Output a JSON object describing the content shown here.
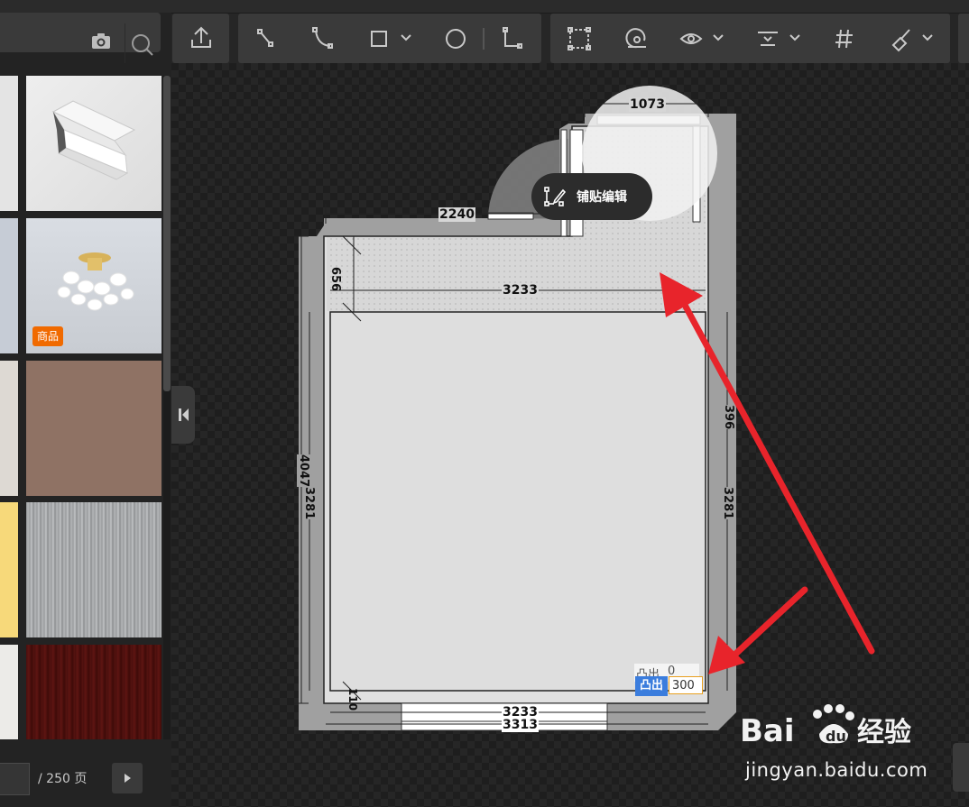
{
  "toolbar": {
    "groups": [
      {
        "name": "upload-group",
        "tools": [
          "upload-icon"
        ]
      },
      {
        "name": "draw-group",
        "tools": [
          "line-tool-icon",
          "arc-tool-icon",
          "rect-tool-icon",
          "circle-tool-icon",
          "corner-tool-icon"
        ]
      },
      {
        "name": "view-group",
        "tools": [
          "select-region-icon",
          "spiral-icon",
          "eye-icon",
          "align-icon",
          "grid-icon",
          "brush-icon"
        ]
      }
    ]
  },
  "sidebar": {
    "tiles": [
      {
        "name": "partial-tile-1",
        "badge": ""
      },
      {
        "name": "crown-molding",
        "badge": ""
      },
      {
        "name": "partial-tile-2",
        "badge": ""
      },
      {
        "name": "ceiling-lamp",
        "badge": "商品"
      },
      {
        "name": "partial-tile-3",
        "badge": ""
      },
      {
        "name": "brown-material",
        "badge": ""
      },
      {
        "name": "yellow-material",
        "badge": ""
      },
      {
        "name": "gray-metal-material",
        "badge": ""
      },
      {
        "name": "white-material",
        "badge": ""
      },
      {
        "name": "dark-wood-material",
        "badge": ""
      }
    ],
    "pager": {
      "total": "/ 250 页"
    }
  },
  "popup": {
    "label": "铺贴编辑"
  },
  "plan": {
    "dims": {
      "top_width": "1073",
      "left_top": "2240",
      "side_small": "656",
      "inner_width": "3233",
      "left_outer": "4047",
      "left_inner": "3281",
      "right_inner": "3281",
      "right_top": "396",
      "bottom_small": "110",
      "bottom_inner": "3233",
      "bottom_outer": "3313"
    },
    "overlay_ghost": {
      "label": "凸出",
      "value": "0"
    },
    "tuchu": {
      "label": "凸出",
      "value": "300"
    }
  },
  "watermark": {
    "brand": "Bai du 经验",
    "url": "jingyan.baidu.com"
  },
  "colors": {
    "arrow": "#e8242b",
    "badge_blue": "#3b7ddd",
    "badge_orange": "#f06a00"
  }
}
